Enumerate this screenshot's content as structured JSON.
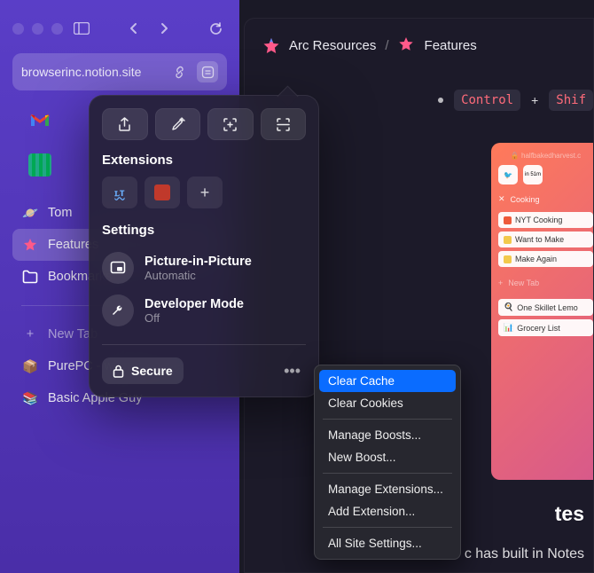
{
  "sidebar": {
    "url": "browserinc.notion.site",
    "items": [
      {
        "label": "Tom",
        "icon": "planet"
      },
      {
        "label": "Features",
        "icon": "star",
        "active": true
      },
      {
        "label": "Bookmarks",
        "icon": "folder"
      }
    ],
    "new_tab_label": "New Tab",
    "feeds": [
      {
        "label": "PurePC - wiemy, co się…",
        "icon": "cube"
      },
      {
        "label": "Basic Apple Guy",
        "icon": "books"
      }
    ]
  },
  "breadcrumb": {
    "root": "Arc Resources",
    "leaf": "Features"
  },
  "keyboard": {
    "key1": "Control",
    "plus": "+",
    "key2": "Shif"
  },
  "content": {
    "title_fragment": "tes",
    "body_fragment": "c has built in Notes"
  },
  "thumbnail": {
    "url": "halfbakedharvest.c",
    "tab_text": "in 51m",
    "rows": [
      {
        "icon": "x",
        "label": "Cooking"
      },
      {
        "icon": "card",
        "label": "NYT Cooking",
        "card": true,
        "color": "#ee5a3a"
      },
      {
        "icon": "card",
        "label": "Want to Make",
        "card": true,
        "color": "#f2c94c"
      },
      {
        "icon": "card",
        "label": "Make Again",
        "card": true,
        "color": "#f2c94c"
      }
    ],
    "new_tab": "New Tab",
    "bottom": [
      {
        "label": "One Skillet Lemo"
      },
      {
        "label": "Grocery List"
      }
    ]
  },
  "popover": {
    "extensions_heading": "Extensions",
    "settings_heading": "Settings",
    "settings": [
      {
        "title": "Picture-in-Picture",
        "sub": "Automatic"
      },
      {
        "title": "Developer Mode",
        "sub": "Off"
      }
    ],
    "secure_label": "Secure"
  },
  "context_menu": {
    "items": [
      {
        "label": "Clear Cache",
        "selected": true
      },
      {
        "label": "Clear Cookies"
      },
      {
        "divider": true
      },
      {
        "label": "Manage Boosts..."
      },
      {
        "label": "New Boost..."
      },
      {
        "divider": true
      },
      {
        "label": "Manage Extensions..."
      },
      {
        "label": "Add Extension..."
      },
      {
        "divider": true
      },
      {
        "label": "All Site Settings..."
      }
    ]
  }
}
